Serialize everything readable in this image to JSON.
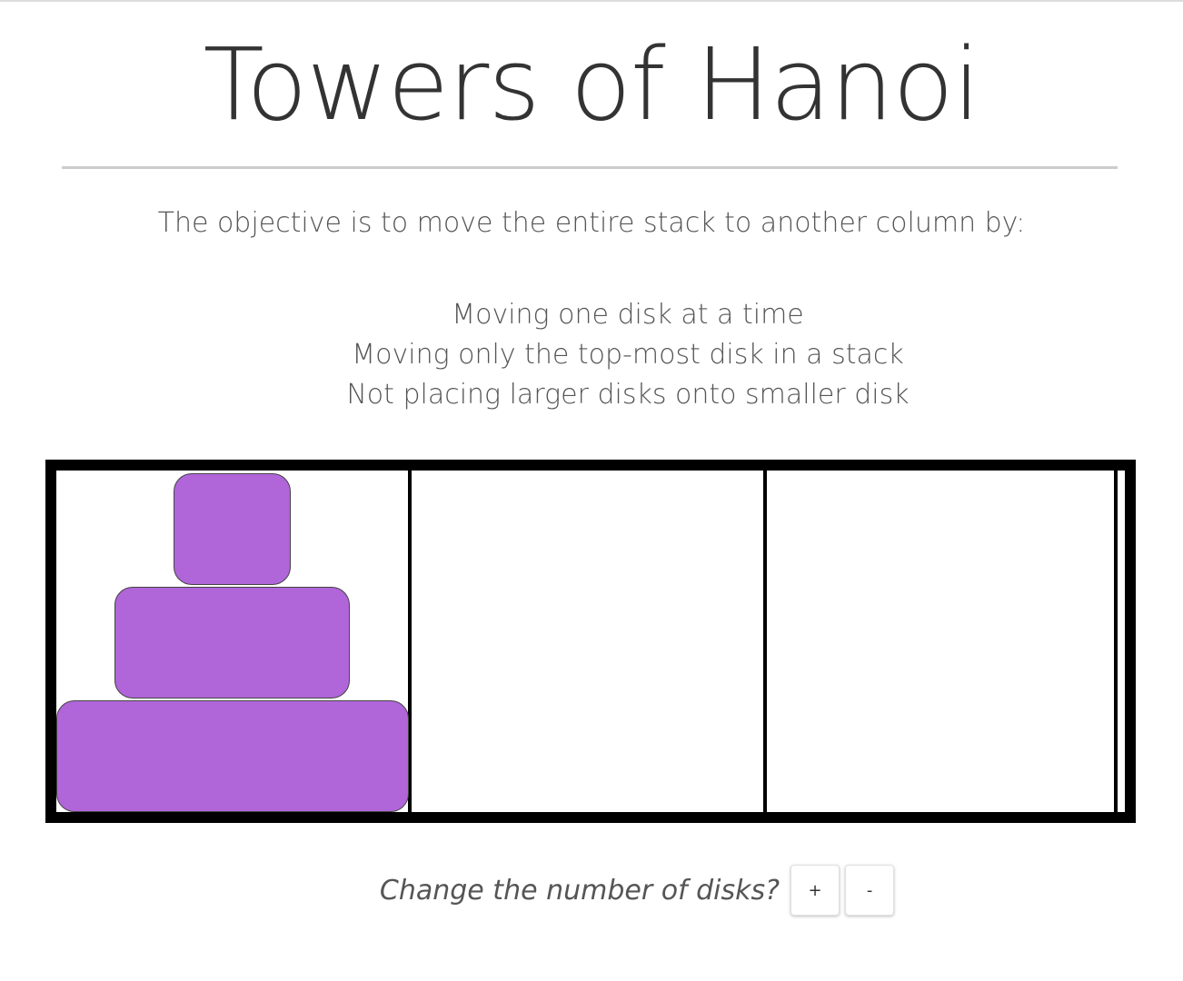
{
  "title": "Towers of Hanoi",
  "objective": "The objective is to move the entire stack to another column by:",
  "rules": [
    "Moving one disk at a time",
    "Moving only the top-most disk in a stack",
    "Not placing larger disks onto smaller disk"
  ],
  "board": {
    "disk_color": "#b065d9",
    "border_color": "#000000",
    "towers": [
      {
        "disks": [
          1,
          2,
          3
        ]
      },
      {
        "disks": []
      },
      {
        "disks": []
      }
    ]
  },
  "controls": {
    "label": "Change the number of disks?",
    "increase_label": "+",
    "decrease_label": "-"
  }
}
